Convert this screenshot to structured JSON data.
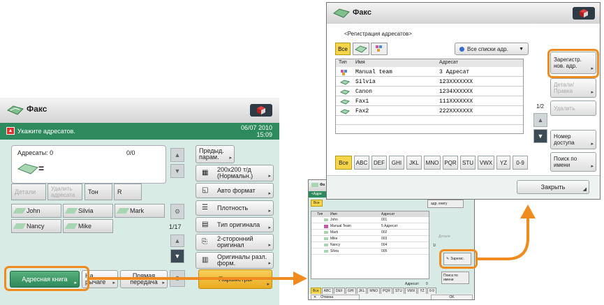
{
  "left": {
    "title": "Факс",
    "status_message": "Укажите адресатов.",
    "date": "06/07 2010",
    "time": "15:09",
    "recipients_label": "Адресаты: 0",
    "recipients_count": "0/0",
    "equals": "=",
    "details_btn": "Детали",
    "delete_recipient_btn": "Удалить адресата",
    "tone_btn": "Тон",
    "r_btn": "R",
    "prev_settings_btn": "Предыд. парам.",
    "resolution_btn": "200x200 т/д (Нормальн.)",
    "auto_format_btn": "Авто формат",
    "density_btn": "Плотность",
    "original_type_btn": "Тип оригинала",
    "duplex_btn": "2-сторонний оригинал",
    "mixed_btn": "Оригиналы разл. форм.",
    "quick_contacts": [
      "John",
      "Silvia",
      "Mark",
      "Nancy",
      "Mike"
    ],
    "page_indicator": "1/17",
    "address_book_btn": "Адресная книга",
    "on_hook_btn": "На рычаге",
    "direct_send_btn": "Прямая передача",
    "options_btn": "Параметры"
  },
  "right": {
    "title": "Факс",
    "subtitle": "<Регистрация адресатов>",
    "all_tab": "Все",
    "all_lists_dropdown": "Все списки адр.",
    "columns": [
      "Тип",
      "Имя",
      "Адресат"
    ],
    "rows": [
      {
        "icon": "group-icon",
        "name": "Manual team",
        "address": "3 Адресат"
      },
      {
        "icon": "fax-icon",
        "name": "Silvia",
        "address": "123XXXXXXX"
      },
      {
        "icon": "fax-icon",
        "name": "Canon",
        "address": "1234XXXXXX"
      },
      {
        "icon": "fax-icon",
        "name": "Fax1",
        "address": "111XXXXXXX"
      },
      {
        "icon": "fax-icon",
        "name": "Fax2",
        "address": "222XXXXXXX"
      }
    ],
    "register_btn": "Зарегистр. нов. адр.",
    "details_edit_btn": "Детали/ Правка",
    "delete_btn": "Удалить",
    "page_indicator": "1/2",
    "access_number_btn": "Номер доступа",
    "search_by_name_btn": "Поиск по имени",
    "letter_tabs": [
      "Все",
      "ABC",
      "DEF",
      "GHI",
      "JKL",
      "MNO",
      "PQR",
      "STU",
      "VWX",
      "YZ",
      "0-9"
    ],
    "close_btn": "Закрыть"
  },
  "mid": {
    "title": "Фа",
    "subtitle": "<Адре",
    "all_tab": "Все",
    "book_btn": "адр. книгу",
    "columns": [
      "Тип",
      "Имя",
      "Адресат"
    ],
    "rows": [
      {
        "name": "John",
        "address": "001"
      },
      {
        "name": "Manual Team",
        "address": "5 Адресат"
      },
      {
        "name": "Mark",
        "address": "002"
      },
      {
        "name": "Mike",
        "address": "003"
      },
      {
        "name": "Nancy",
        "address": "004"
      },
      {
        "name": "Silvia",
        "address": "005"
      }
    ],
    "details_btn": "Детали",
    "page_indicator": "1/",
    "register_btn": "Зарегис.",
    "recipients_label": "Адресат:",
    "recipients_count": "0",
    "search_btn": "Поиск по имени",
    "letter_tabs": [
      "Все",
      "ABC",
      "DEF",
      "GHI",
      "JKL",
      "MNO",
      "PQR",
      "STU",
      "VWX",
      "YZ",
      "0-9"
    ],
    "cancel_btn": "Отмена",
    "ok_btn": "OK"
  },
  "colors": {
    "accent": "#f08c1f",
    "green": "#2d8a5c",
    "panel": "#d9ebe5"
  }
}
